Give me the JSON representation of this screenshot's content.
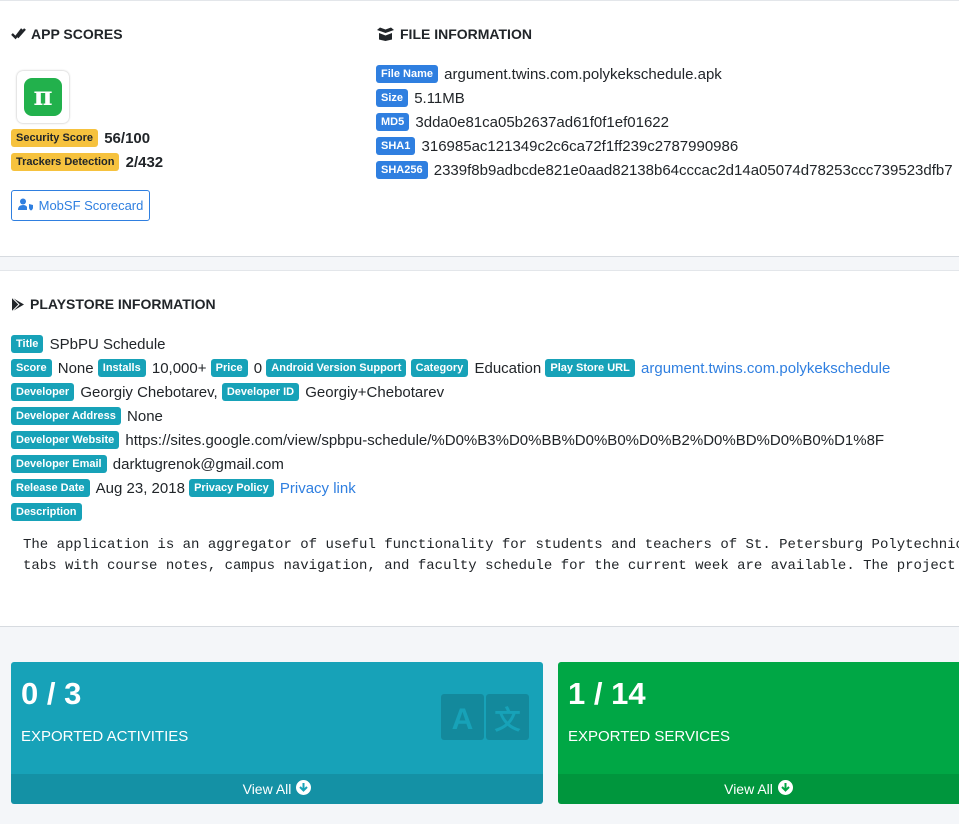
{
  "app_scores": {
    "title": "APP SCORES",
    "security_score_label": "Security Score",
    "security_score_value": "56/100",
    "trackers_label": "Trackers Detection",
    "trackers_value": "2/432",
    "scorecard_button": "MobSF Scorecard"
  },
  "file_info": {
    "title": "FILE INFORMATION",
    "rows": [
      {
        "label": "File Name",
        "value": "argument.twins.com.polykekschedule.apk"
      },
      {
        "label": "Size",
        "value": "5.11MB"
      },
      {
        "label": "MD5",
        "value": "3dda0e81ca05b2637ad61f0f1ef01622"
      },
      {
        "label": "SHA1",
        "value": "316985ac121349c2c6ca72f1ff239c2787990986"
      },
      {
        "label": "SHA256",
        "value": "2339f8b9adbcde821e0aad82138b64cccac2d14a05074d78253ccc739523dfb7"
      }
    ]
  },
  "playstore": {
    "title": "PLAYSTORE INFORMATION",
    "title_label": "Title",
    "title_value": "SPbPU Schedule",
    "score_label": "Score",
    "score_value": "None",
    "installs_label": "Installs",
    "installs_value": "10,000+",
    "price_label": "Price",
    "price_value": "0",
    "android_label": "Android Version Support",
    "category_label": "Category",
    "category_value": "Education",
    "url_label": "Play Store URL",
    "url_value": "argument.twins.com.polykekschedule",
    "developer_label": "Developer",
    "developer_value": "Georgiy Chebotarev,",
    "developer_id_label": "Developer ID",
    "developer_id_value": "Georgiy+Chebotarev",
    "developer_address_label": "Developer Address",
    "developer_address_value": "None",
    "developer_website_label": "Developer Website",
    "developer_website_value": "https://sites.google.com/view/spbpu-schedule/%D0%B3%D0%BB%D0%B0%D0%B2%D0%BD%D0%B0%D1%8F",
    "developer_email_label": "Developer Email",
    "developer_email_value": "darktugrenok@gmail.com",
    "release_label": "Release Date",
    "release_value": "Aug 23, 2018",
    "privacy_label": "Privacy Policy",
    "privacy_value": "Privacy link",
    "description_label": "Description",
    "description_line1": "The application is an aggregator of useful functionality for students and teachers of St. Petersburg Polytechnic",
    "description_line2": "tabs with course notes, campus navigation, and faculty schedule for the current week are available. The project"
  },
  "stats": {
    "activities_value": "0 / 3",
    "activities_label": "EXPORTED ACTIVITIES",
    "services_value": "1 / 14",
    "services_label": "EXPORTED SERVICES",
    "view_all": "View All"
  },
  "colors": {
    "primary": "#2f7fe0",
    "info": "#17a2b8",
    "success": "#00a745",
    "warning": "#f6c23e"
  },
  "icons": [
    "check-double-icon",
    "box-open-icon",
    "play-icon",
    "user-shield-icon",
    "arrow-circle-down-icon",
    "language-icon"
  ]
}
